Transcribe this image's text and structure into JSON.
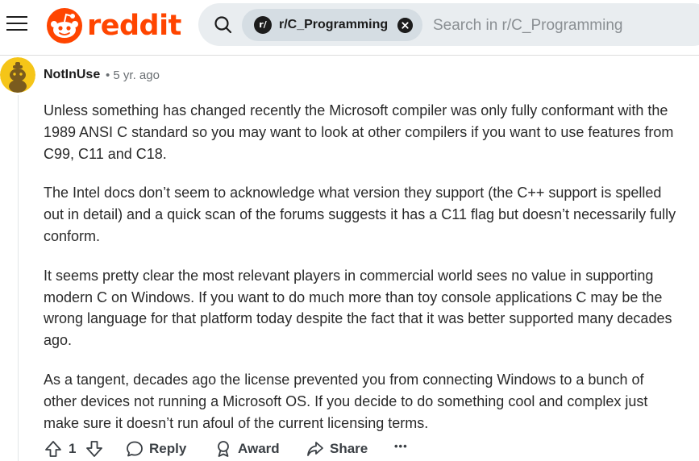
{
  "header": {
    "logo_text": "reddit",
    "brand_color": "#ff4500",
    "chip": {
      "badge": "r/",
      "label": "r/C_Programming"
    },
    "search": {
      "placeholder": "Search in r/C_Programming",
      "value": ""
    }
  },
  "comment": {
    "author": "NotInUse",
    "meta": "• 5 yr. ago",
    "paragraphs": [
      "Unless something has changed recently the Microsoft compiler was only fully conformant with the 1989 ANSI C standard so you may want to look at other compilers if you want to use features from C99, C11 and C18.",
      "The Intel docs don’t seem to acknowledge what version they support (the C++ support is spelled out in detail) and a quick scan of the forums suggests it has a C11 flag but doesn’t necessarily fully conform.",
      "It seems pretty clear the most relevant players in commercial world sees no value in supporting modern C on Windows. If you want to do much more than toy console applications C may be the wrong language for that platform today despite the fact that it was better supported many decades ago.",
      "As a tangent, decades ago the license prevented you from connecting Windows to a bunch of other devices not running a Microsoft OS. If you decide to do something cool and complex just make sure it doesn’t run afoul of the current licensing terms."
    ],
    "actions": {
      "vote_count": "1",
      "reply_label": "Reply",
      "award_label": "Award",
      "share_label": "Share",
      "more_label": "•••"
    }
  },
  "icons": [
    "hamburger-menu-icon",
    "reddit-snoo-icon",
    "search-icon",
    "close-icon",
    "upvote-icon",
    "downvote-icon",
    "comment-icon",
    "award-icon",
    "share-icon",
    "more-icon"
  ]
}
